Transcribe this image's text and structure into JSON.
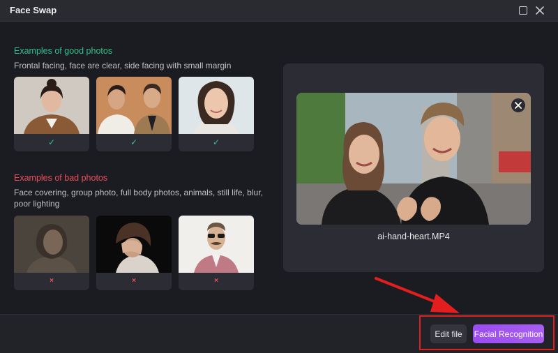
{
  "window": {
    "title": "Face Swap",
    "maximize_icon": "square-icon",
    "close_icon": "close-icon"
  },
  "good_section": {
    "title": "Examples of good photos",
    "description": "Frontal facing, face are clear, side facing with small margin",
    "color": "#2fc38d",
    "cards": [
      {
        "photo": "woman-portrait-brown-coat",
        "mark": "✓"
      },
      {
        "photo": "two-young-men-portrait",
        "mark": "✓"
      },
      {
        "photo": "smiling-woman-closeup",
        "mark": "✓"
      }
    ]
  },
  "bad_section": {
    "title": "Examples of bad photos",
    "description": "Face covering, group photo, full body photos, animals, still life, blur, poor lighting",
    "color": "#ee4e5c",
    "cards": [
      {
        "photo": "blurry-dim-woman",
        "mark": "×"
      },
      {
        "photo": "woman-covering-face-dark",
        "mark": "×"
      },
      {
        "photo": "man-sunglasses-mustache",
        "mark": "×"
      }
    ]
  },
  "preview": {
    "file_name": "ai-hand-heart.MP4",
    "close_icon": "close-icon",
    "photo": "couple-hand-heart-city-street"
  },
  "footer": {
    "edit_label": "Edit file",
    "facial_label": "Facial Recognition",
    "accent": "#9a4cf0"
  },
  "annotation": {
    "arrow_color": "#e31e1e",
    "box_color": "#e31e1e"
  }
}
